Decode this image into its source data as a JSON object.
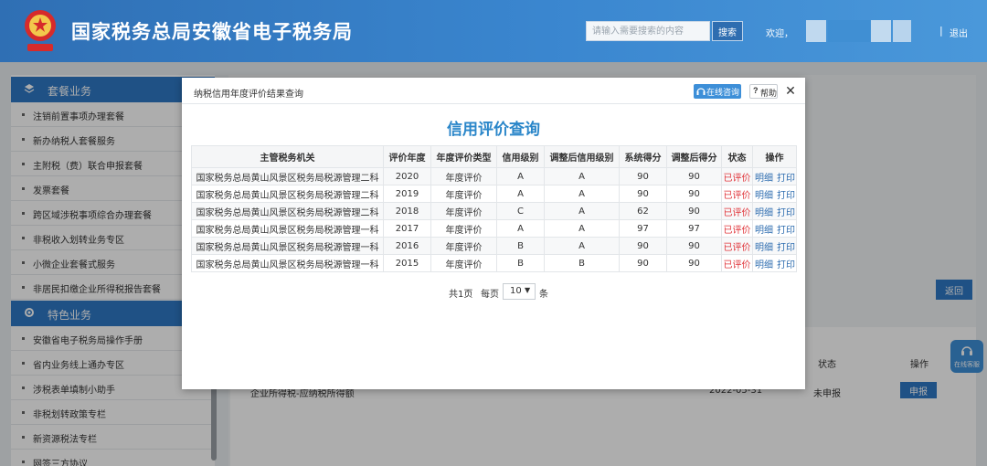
{
  "header": {
    "site_title": "国家税务总局安徽省电子税务局",
    "search_placeholder": "请输入需要搜索的内容",
    "search_label": "搜索",
    "welcome": "欢迎，",
    "separator": "|",
    "logout_label": "退出"
  },
  "sidebar": {
    "groups": [
      {
        "title": "套餐业务",
        "items": [
          "注销前置事项办理套餐",
          "新办纳税人套餐服务",
          "主附税（费）联合申报套餐",
          "发票套餐",
          "跨区域涉税事项综合办理套餐",
          "非税收入划转业务专区",
          "小微企业套餐式服务",
          "非居民扣缴企业所得税报告套餐"
        ]
      },
      {
        "title": "特色业务",
        "items": [
          "安徽省电子税务局操作手册",
          "省内业务线上通办专区",
          "涉税表单填制小助手",
          "非税划转政策专栏",
          "新资源税法专栏",
          "网签三方协议"
        ]
      }
    ]
  },
  "background": {
    "back_label": "返回",
    "col_status": "状态",
    "col_op": "操作",
    "row_text": "企业所得税-应纳税所得额",
    "row_date": "2022-05-31",
    "row_status": "未申报",
    "declare_label": "申报",
    "float_service": "在线客服"
  },
  "modal": {
    "title": "纳税信用年度评价结果查询",
    "online_label": "在线咨询",
    "help_q": "?",
    "help_label": "帮助",
    "close": "✕",
    "heading": "信用评价查询",
    "columns": [
      "主管税务机关",
      "评价年度",
      "年度评价类型",
      "信用级别",
      "调整后信用级别",
      "系统得分",
      "调整后得分",
      "状态",
      "操作"
    ],
    "rows": [
      [
        "国家税务总局黄山风景区税务局税源管理二科",
        "2020",
        "年度评价",
        "A",
        "A",
        "90",
        "90",
        "已评价",
        "明细",
        "打印"
      ],
      [
        "国家税务总局黄山风景区税务局税源管理二科",
        "2019",
        "年度评价",
        "A",
        "A",
        "90",
        "90",
        "已评价",
        "明细",
        "打印"
      ],
      [
        "国家税务总局黄山风景区税务局税源管理二科",
        "2018",
        "年度评价",
        "C",
        "A",
        "62",
        "90",
        "已评价",
        "明细",
        "打印"
      ],
      [
        "国家税务总局黄山风景区税务局税源管理一科",
        "2017",
        "年度评价",
        "A",
        "A",
        "97",
        "97",
        "已评价",
        "明细",
        "打印"
      ],
      [
        "国家税务总局黄山风景区税务局税源管理一科",
        "2016",
        "年度评价",
        "B",
        "A",
        "90",
        "90",
        "已评价",
        "明细",
        "打印"
      ],
      [
        "国家税务总局黄山风景区税务局税源管理一科",
        "2015",
        "年度评价",
        "B",
        "B",
        "90",
        "90",
        "已评价",
        "明细",
        "打印"
      ]
    ],
    "pager": {
      "total": "共1页",
      "per_page": "每页",
      "page_size": "10",
      "unit": "条"
    }
  },
  "colors": {
    "header_blue": "#2f6fb4",
    "accent_blue": "#2a86c9",
    "status_red": "#e0343a",
    "link_blue": "#2e6db0"
  }
}
